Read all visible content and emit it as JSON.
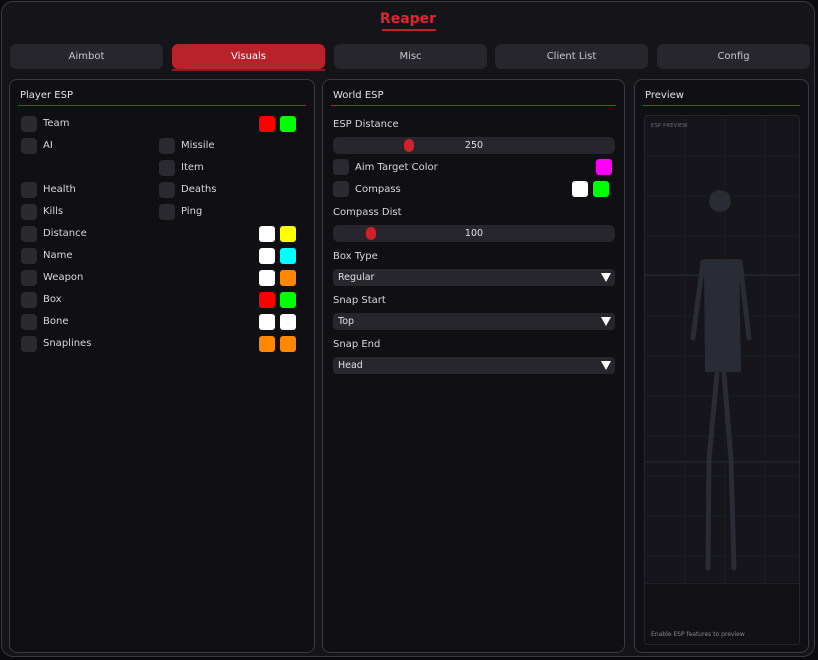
{
  "app": {
    "title": "Reaper"
  },
  "tabs": [
    {
      "label": "Aimbot",
      "active": false
    },
    {
      "label": "Visuals",
      "active": true
    },
    {
      "label": "Misc",
      "active": false
    },
    {
      "label": "Client List",
      "active": false
    },
    {
      "label": "Config",
      "active": false
    }
  ],
  "player_esp": {
    "title": "Player ESP",
    "rows": [
      {
        "label": "Team",
        "colors": [
          "#ff0000",
          "#00ff00"
        ]
      },
      {
        "label": "AI",
        "right_label": "Missile"
      },
      {
        "right_label": "Item"
      },
      {
        "label": "Health",
        "right_label": "Deaths"
      },
      {
        "label": "Kills",
        "right_label": "Ping"
      },
      {
        "label": "Distance",
        "colors": [
          "#ffffff",
          "#ffff00"
        ]
      },
      {
        "label": "Name",
        "colors": [
          "#ffffff",
          "#00ffff"
        ]
      },
      {
        "label": "Weapon",
        "colors": [
          "#ffffff",
          "#ff8800"
        ]
      },
      {
        "label": "Box",
        "colors": [
          "#ff0000",
          "#00ff00"
        ]
      },
      {
        "label": "Bone",
        "colors": [
          "#ffffff",
          "#ffffff"
        ]
      },
      {
        "label": "Snaplines",
        "colors": [
          "#ff8800",
          "#ff8800"
        ]
      }
    ]
  },
  "world_esp": {
    "title": "World ESP",
    "esp_distance_label": "ESP Distance",
    "esp_distance_value": "250",
    "esp_distance_fraction": 0.26,
    "aim_target_label": "Aim Target Color",
    "aim_target_color": "#ff00ff",
    "compass_label": "Compass",
    "compass_colors": [
      "#ffffff",
      "#00ff00"
    ],
    "compass_dist_label": "Compass Dist",
    "compass_dist_value": "100",
    "compass_dist_fraction": 0.12,
    "box_type_label": "Box Type",
    "box_type_value": "Regular",
    "snap_start_label": "Snap Start",
    "snap_start_value": "Top",
    "snap_end_label": "Snap End",
    "snap_end_value": "Head"
  },
  "preview": {
    "title": "Preview",
    "tag": "ESP PREVIEW",
    "footer": "Enable ESP features to preview"
  },
  "colors": {
    "accent": "#c41f27"
  }
}
